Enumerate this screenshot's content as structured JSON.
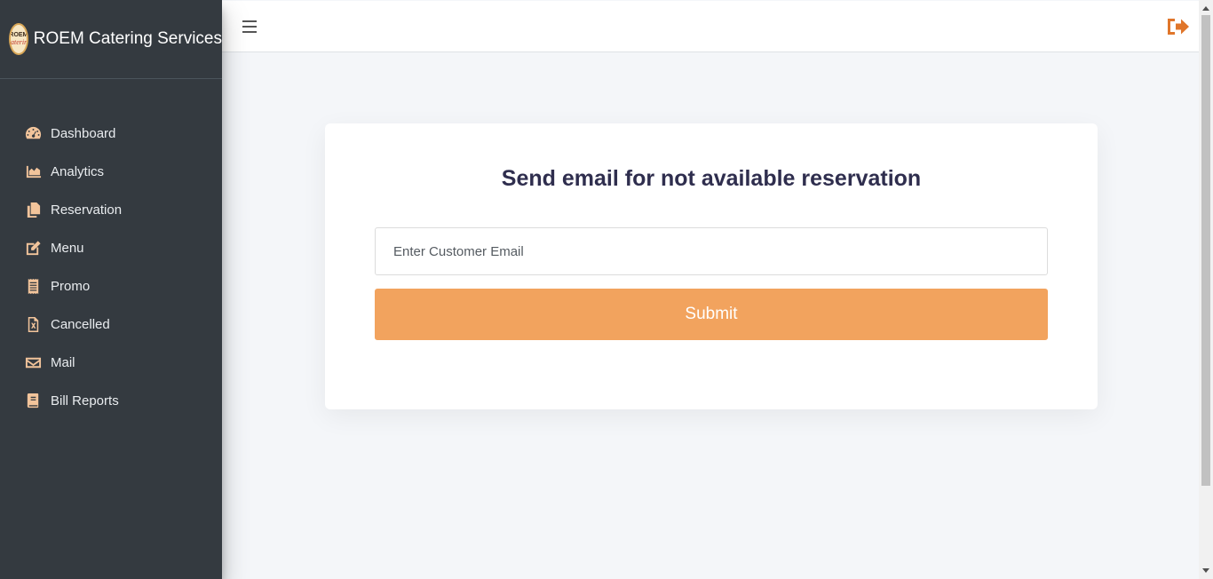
{
  "brand": {
    "name": "ROEM Catering Services",
    "logo_line1": "ROEM",
    "logo_line2": "Catering"
  },
  "sidebar": {
    "items": [
      {
        "label": "Dashboard",
        "icon": "dashboard-gauge-icon"
      },
      {
        "label": "Analytics",
        "icon": "area-chart-icon"
      },
      {
        "label": "Reservation",
        "icon": "copy-files-icon"
      },
      {
        "label": "Menu",
        "icon": "edit-icon"
      },
      {
        "label": "Promo",
        "icon": "receipt-icon"
      },
      {
        "label": "Cancelled",
        "icon": "file-excel-icon"
      },
      {
        "label": "Mail",
        "icon": "envelope-icon"
      },
      {
        "label": "Bill Reports",
        "icon": "book-icon"
      }
    ]
  },
  "topbar": {
    "menu_icon": "hamburger-icon",
    "logout_icon": "sign-out-icon"
  },
  "form": {
    "title": "Send email for not available reservation",
    "email_placeholder": "Enter Customer Email",
    "email_value": "",
    "submit_label": "Submit"
  },
  "colors": {
    "sidebar_bg": "#343a40",
    "accent": "#f2a35e",
    "icon": "#f2c49b",
    "logout": "#e0762b",
    "title": "#2f2e4e"
  }
}
